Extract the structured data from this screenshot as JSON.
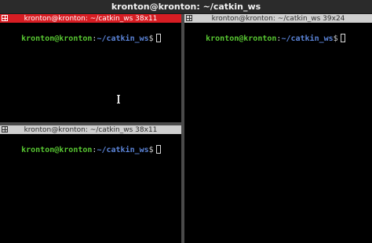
{
  "window": {
    "title": "kronton@kronton: ~/catkin_ws"
  },
  "panes": [
    {
      "id": "top-left",
      "title": "kronton@kronton: ~/catkin_ws 38x11",
      "active": true,
      "prompt": {
        "user_host": "kronton@kronton",
        "colon": ":",
        "path": "~/catkin_ws",
        "symbol": "$"
      }
    },
    {
      "id": "bottom-left",
      "title": "kronton@kronton: ~/catkin_ws 38x11",
      "active": false,
      "prompt": {
        "user_host": "kronton@kronton",
        "colon": ":",
        "path": "~/catkin_ws",
        "symbol": "$"
      }
    },
    {
      "id": "right",
      "title": "kronton@kronton: ~/catkin_ws 39x24",
      "active": false,
      "prompt": {
        "user_host": "kronton@kronton",
        "colon": ":",
        "path": "~/catkin_ws",
        "symbol": "$"
      }
    }
  ],
  "colors": {
    "active_bar": "#d71d23",
    "inactive_bar": "#cfcfcf",
    "prompt_user": "#58c732",
    "prompt_path": "#5b84d8",
    "background": "#000000"
  },
  "icons": {
    "pane_split": "split-pane-icon",
    "mouse_cursor": "text-cursor-icon"
  }
}
